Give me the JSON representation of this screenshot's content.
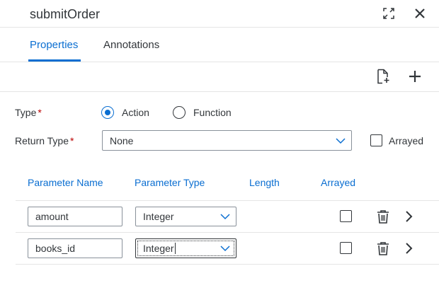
{
  "header": {
    "title": "submitOrder"
  },
  "tabs": [
    {
      "label": "Properties",
      "selected": true
    },
    {
      "label": "Annotations",
      "selected": false
    }
  ],
  "form": {
    "type_label": "Type",
    "required_mark": "*",
    "type_options": [
      {
        "label": "Action",
        "selected": true
      },
      {
        "label": "Function",
        "selected": false
      }
    ],
    "return_type_label": "Return Type",
    "return_type_value": "None",
    "arrayed_label": "Arrayed",
    "arrayed_checked": false
  },
  "table": {
    "columns": [
      "Parameter Name",
      "Parameter Type",
      "Length",
      "Arrayed"
    ],
    "rows": [
      {
        "name": "amount",
        "type": "Integer",
        "arrayed": false
      },
      {
        "name": "books_id",
        "type": "Integer",
        "arrayed": false
      }
    ]
  },
  "colors": {
    "accent": "#0a6ed1",
    "required": "#bb0000",
    "text": "#32363a",
    "divider": "#e5e5e5"
  }
}
